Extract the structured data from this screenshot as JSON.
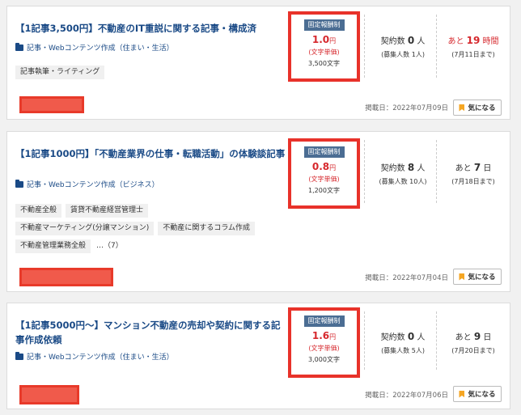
{
  "jobs": [
    {
      "title": "【1記事3,500円】不動産のIT重説に関する記事・構成済",
      "category": "記事・Webコンテンツ作成（住まい・生活）",
      "tags": [
        "記事執筆・ライティング"
      ],
      "more": "",
      "badge": "固定報酬制",
      "price_value": "1.0",
      "price_unit": "円",
      "price_note": "(文字単価)",
      "char_count": "3,500文字",
      "contract_prefix": "契約数",
      "contract_count": "0",
      "contract_suffix": "人",
      "recruit": "(募集人数 1人)",
      "remain_prefix": "あと",
      "remain_value": "19",
      "remain_unit": "時間",
      "deadline": "(7月11日まで)",
      "posted": "掲載日：2022年07月09日",
      "fav_label": "気になる"
    },
    {
      "title": "【1記事1000円】「不動産業界の仕事・転職活動」の体験談記事",
      "category": "記事・Webコンテンツ作成（ビジネス）",
      "tags": [
        "不動産全般",
        "賃貸不動産経営管理士",
        "不動産マーケティング(分譲マンション)",
        "不動産に関するコラム作成",
        "不動産管理業務全般"
      ],
      "more": "…（7）",
      "badge": "固定報酬制",
      "price_value": "0.8",
      "price_unit": "円",
      "price_note": "(文字単価)",
      "char_count": "1,200文字",
      "contract_prefix": "契約数",
      "contract_count": "8",
      "contract_suffix": "人",
      "recruit": "(募集人数 10人)",
      "remain_prefix": "あと",
      "remain_value": "7",
      "remain_unit": "日",
      "deadline": "(7月18日まで)",
      "posted": "掲載日：2022年07月04日",
      "fav_label": "気になる"
    },
    {
      "title": "【1記事5000円〜】マンション不動産の売却や契約に関する記事作成依頼",
      "category": "記事・Webコンテンツ作成（住まい・生活）",
      "tags": [],
      "more": "",
      "badge": "固定報酬制",
      "price_value": "1.6",
      "price_unit": "円",
      "price_note": "(文字単価)",
      "char_count": "3,000文字",
      "contract_prefix": "契約数",
      "contract_count": "0",
      "contract_suffix": "人",
      "recruit": "(募集人数 5人)",
      "remain_prefix": "あと",
      "remain_value": "9",
      "remain_unit": "日",
      "deadline": "(7月20日まで)",
      "posted": "掲載日：2022年07月06日",
      "fav_label": "気になる"
    }
  ],
  "colors": {
    "title": "#1a4a86",
    "price_red": "#d6282d",
    "badge_bg": "#4b6d93",
    "highlight_border": "#e8322a",
    "bookmark": "#f5a623"
  }
}
